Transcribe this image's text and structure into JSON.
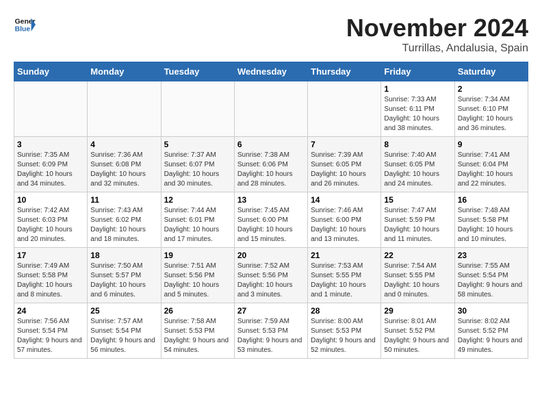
{
  "logo": {
    "text_general": "General",
    "text_blue": "Blue"
  },
  "title": "November 2024",
  "location": "Turrillas, Andalusia, Spain",
  "weekdays": [
    "Sunday",
    "Monday",
    "Tuesday",
    "Wednesday",
    "Thursday",
    "Friday",
    "Saturday"
  ],
  "weeks": [
    [
      {
        "day": "",
        "info": ""
      },
      {
        "day": "",
        "info": ""
      },
      {
        "day": "",
        "info": ""
      },
      {
        "day": "",
        "info": ""
      },
      {
        "day": "",
        "info": ""
      },
      {
        "day": "1",
        "info": "Sunrise: 7:33 AM\nSunset: 6:11 PM\nDaylight: 10 hours and 38 minutes."
      },
      {
        "day": "2",
        "info": "Sunrise: 7:34 AM\nSunset: 6:10 PM\nDaylight: 10 hours and 36 minutes."
      }
    ],
    [
      {
        "day": "3",
        "info": "Sunrise: 7:35 AM\nSunset: 6:09 PM\nDaylight: 10 hours and 34 minutes."
      },
      {
        "day": "4",
        "info": "Sunrise: 7:36 AM\nSunset: 6:08 PM\nDaylight: 10 hours and 32 minutes."
      },
      {
        "day": "5",
        "info": "Sunrise: 7:37 AM\nSunset: 6:07 PM\nDaylight: 10 hours and 30 minutes."
      },
      {
        "day": "6",
        "info": "Sunrise: 7:38 AM\nSunset: 6:06 PM\nDaylight: 10 hours and 28 minutes."
      },
      {
        "day": "7",
        "info": "Sunrise: 7:39 AM\nSunset: 6:05 PM\nDaylight: 10 hours and 26 minutes."
      },
      {
        "day": "8",
        "info": "Sunrise: 7:40 AM\nSunset: 6:05 PM\nDaylight: 10 hours and 24 minutes."
      },
      {
        "day": "9",
        "info": "Sunrise: 7:41 AM\nSunset: 6:04 PM\nDaylight: 10 hours and 22 minutes."
      }
    ],
    [
      {
        "day": "10",
        "info": "Sunrise: 7:42 AM\nSunset: 6:03 PM\nDaylight: 10 hours and 20 minutes."
      },
      {
        "day": "11",
        "info": "Sunrise: 7:43 AM\nSunset: 6:02 PM\nDaylight: 10 hours and 18 minutes."
      },
      {
        "day": "12",
        "info": "Sunrise: 7:44 AM\nSunset: 6:01 PM\nDaylight: 10 hours and 17 minutes."
      },
      {
        "day": "13",
        "info": "Sunrise: 7:45 AM\nSunset: 6:00 PM\nDaylight: 10 hours and 15 minutes."
      },
      {
        "day": "14",
        "info": "Sunrise: 7:46 AM\nSunset: 6:00 PM\nDaylight: 10 hours and 13 minutes."
      },
      {
        "day": "15",
        "info": "Sunrise: 7:47 AM\nSunset: 5:59 PM\nDaylight: 10 hours and 11 minutes."
      },
      {
        "day": "16",
        "info": "Sunrise: 7:48 AM\nSunset: 5:58 PM\nDaylight: 10 hours and 10 minutes."
      }
    ],
    [
      {
        "day": "17",
        "info": "Sunrise: 7:49 AM\nSunset: 5:58 PM\nDaylight: 10 hours and 8 minutes."
      },
      {
        "day": "18",
        "info": "Sunrise: 7:50 AM\nSunset: 5:57 PM\nDaylight: 10 hours and 6 minutes."
      },
      {
        "day": "19",
        "info": "Sunrise: 7:51 AM\nSunset: 5:56 PM\nDaylight: 10 hours and 5 minutes."
      },
      {
        "day": "20",
        "info": "Sunrise: 7:52 AM\nSunset: 5:56 PM\nDaylight: 10 hours and 3 minutes."
      },
      {
        "day": "21",
        "info": "Sunrise: 7:53 AM\nSunset: 5:55 PM\nDaylight: 10 hours and 1 minute."
      },
      {
        "day": "22",
        "info": "Sunrise: 7:54 AM\nSunset: 5:55 PM\nDaylight: 10 hours and 0 minutes."
      },
      {
        "day": "23",
        "info": "Sunrise: 7:55 AM\nSunset: 5:54 PM\nDaylight: 9 hours and 58 minutes."
      }
    ],
    [
      {
        "day": "24",
        "info": "Sunrise: 7:56 AM\nSunset: 5:54 PM\nDaylight: 9 hours and 57 minutes."
      },
      {
        "day": "25",
        "info": "Sunrise: 7:57 AM\nSunset: 5:54 PM\nDaylight: 9 hours and 56 minutes."
      },
      {
        "day": "26",
        "info": "Sunrise: 7:58 AM\nSunset: 5:53 PM\nDaylight: 9 hours and 54 minutes."
      },
      {
        "day": "27",
        "info": "Sunrise: 7:59 AM\nSunset: 5:53 PM\nDaylight: 9 hours and 53 minutes."
      },
      {
        "day": "28",
        "info": "Sunrise: 8:00 AM\nSunset: 5:53 PM\nDaylight: 9 hours and 52 minutes."
      },
      {
        "day": "29",
        "info": "Sunrise: 8:01 AM\nSunset: 5:52 PM\nDaylight: 9 hours and 50 minutes."
      },
      {
        "day": "30",
        "info": "Sunrise: 8:02 AM\nSunset: 5:52 PM\nDaylight: 9 hours and 49 minutes."
      }
    ]
  ]
}
